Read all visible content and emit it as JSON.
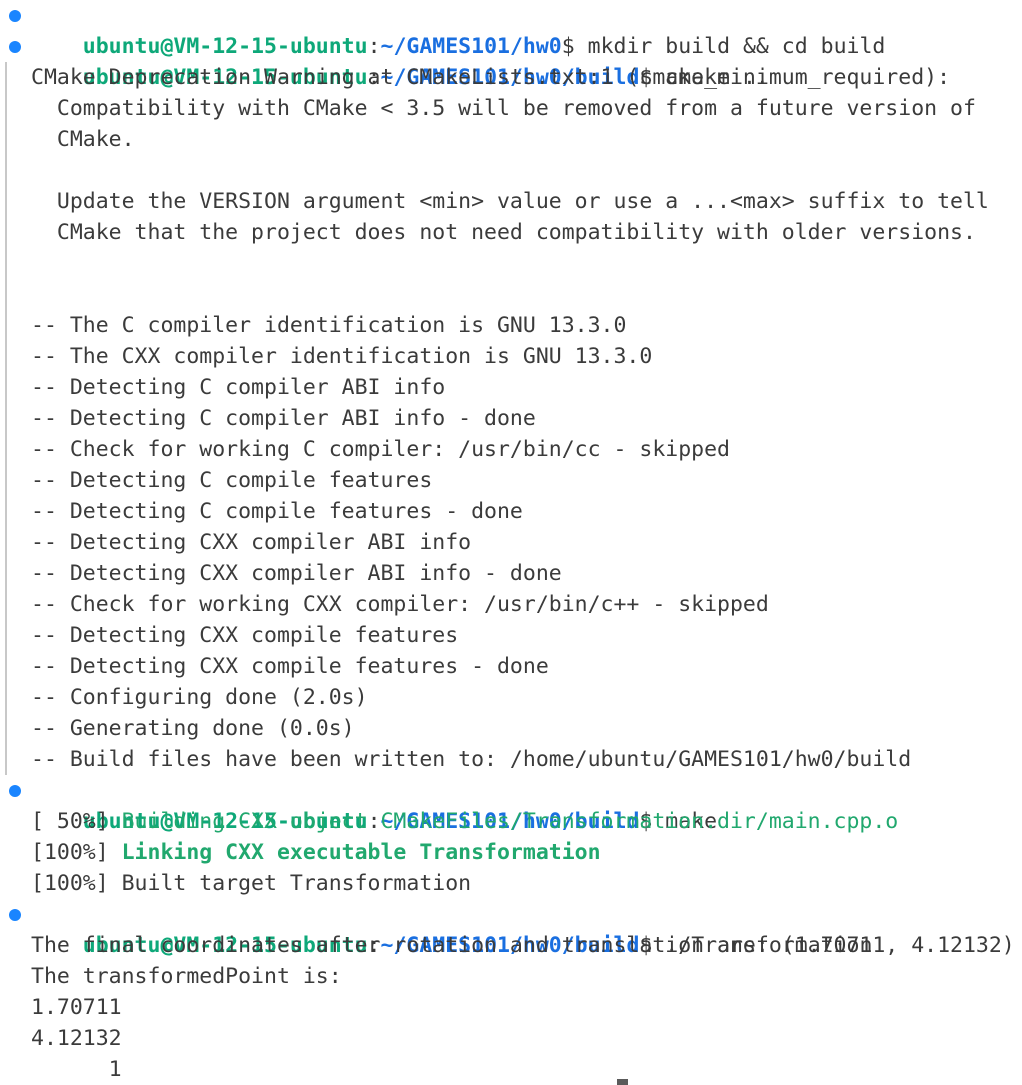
{
  "prompt": {
    "user_host": "ubuntu@VM-12-15-ubuntu",
    "colon": ":",
    "dollar": "$"
  },
  "commands": [
    {
      "path": "~/GAMES101/hw0",
      "command": " mkdir build && cd build"
    },
    {
      "path": "~/GAMES101/hw0/build",
      "command": " cmake .."
    },
    {
      "path": "~/GAMES101/hw0/build",
      "command": " make"
    },
    {
      "path": "~/GAMES101/hw0/build",
      "command": " ./Transformation"
    }
  ],
  "cmake_output": [
    "CMake Deprecation Warning at CMakeLists.txt:1 (cmake_minimum_required):",
    "  Compatibility with CMake < 3.5 will be removed from a future version of",
    "  CMake.",
    "",
    "  Update the VERSION argument <min> value or use a ...<max> suffix to tell",
    "  CMake that the project does not need compatibility with older versions.",
    "",
    "",
    "-- The C compiler identification is GNU 13.3.0",
    "-- The CXX compiler identification is GNU 13.3.0",
    "-- Detecting C compiler ABI info",
    "-- Detecting C compiler ABI info - done",
    "-- Check for working C compiler: /usr/bin/cc - skipped",
    "-- Detecting C compile features",
    "-- Detecting C compile features - done",
    "-- Detecting CXX compiler ABI info",
    "-- Detecting CXX compiler ABI info - done",
    "-- Check for working CXX compiler: /usr/bin/c++ - skipped",
    "-- Detecting CXX compile features",
    "-- Detecting CXX compile features - done",
    "-- Configuring done (2.0s)",
    "-- Generating done (0.0s)",
    "-- Build files have been written to: /home/ubuntu/GAMES101/hw0/build"
  ],
  "make_output": [
    {
      "prefix": "[ 50%] ",
      "text": "Building CXX object CMakeFiles/Transformation.dir/main.cpp.o"
    },
    {
      "prefix": "[100%] ",
      "text": "Linking CXX executable Transformation"
    },
    {
      "prefix": "[100%] ",
      "text": "Built target Transformation"
    }
  ],
  "program_output": [
    "The final coordinates after rotation and translation are: (1.70711, 4.12132)",
    "The transformedPoint is:",
    "1.70711",
    "4.12132",
    "      1"
  ],
  "colors": {
    "prompt_user": "#0ea879",
    "prompt_path": "#1a6fe0",
    "decoration_dot": "#1a85ff",
    "make_progress": "#21a86e",
    "text": "#3b3b3b",
    "background": "#ffffff"
  }
}
